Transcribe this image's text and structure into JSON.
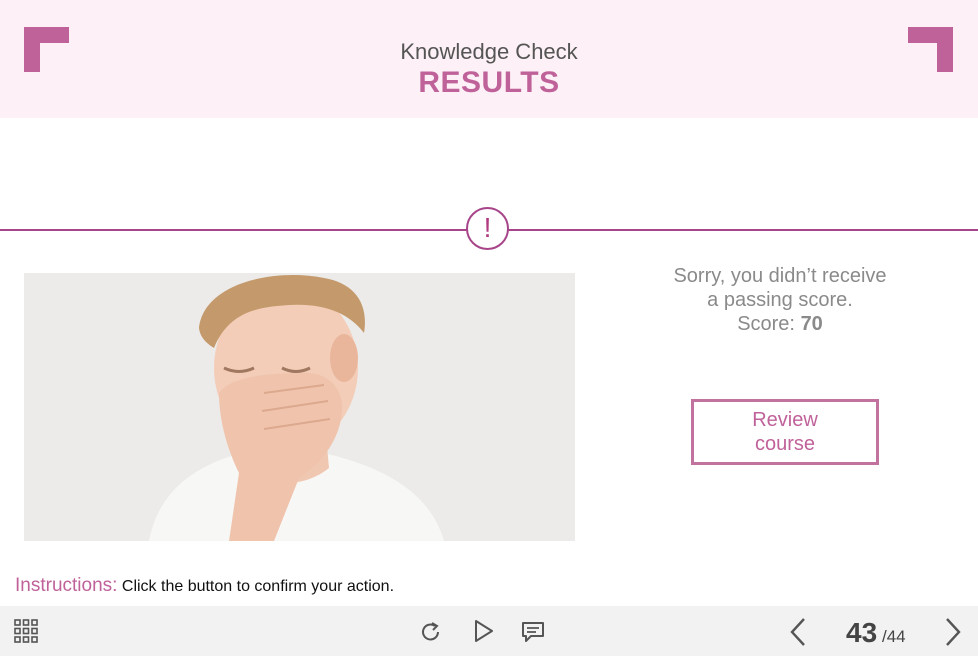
{
  "header": {
    "subtitle": "Knowledge Check",
    "title": "RESULTS"
  },
  "alert": {
    "symbol": "!"
  },
  "photo": {
    "description_icon": "person-facepalm-photo"
  },
  "result": {
    "line1": "Sorry, you didn’t receive",
    "line2": "a passing score.",
    "score_label": "Score:",
    "score_value": "70"
  },
  "review_button": {
    "line1": "Review",
    "line2": "course"
  },
  "instructions": {
    "label": "Instructions:",
    "text": "Click the button to confirm your action."
  },
  "toolbar": {
    "icons": [
      "menu-grid-icon",
      "replay-icon",
      "play-icon",
      "transcript-icon",
      "previous-icon",
      "next-icon"
    ],
    "page_current": "43",
    "page_total": "/44"
  },
  "colors": {
    "accent": "#c0629a",
    "header_bg": "#fdf0f6",
    "divider": "#a8458a",
    "toolbar_bg": "#f2f2f2"
  }
}
